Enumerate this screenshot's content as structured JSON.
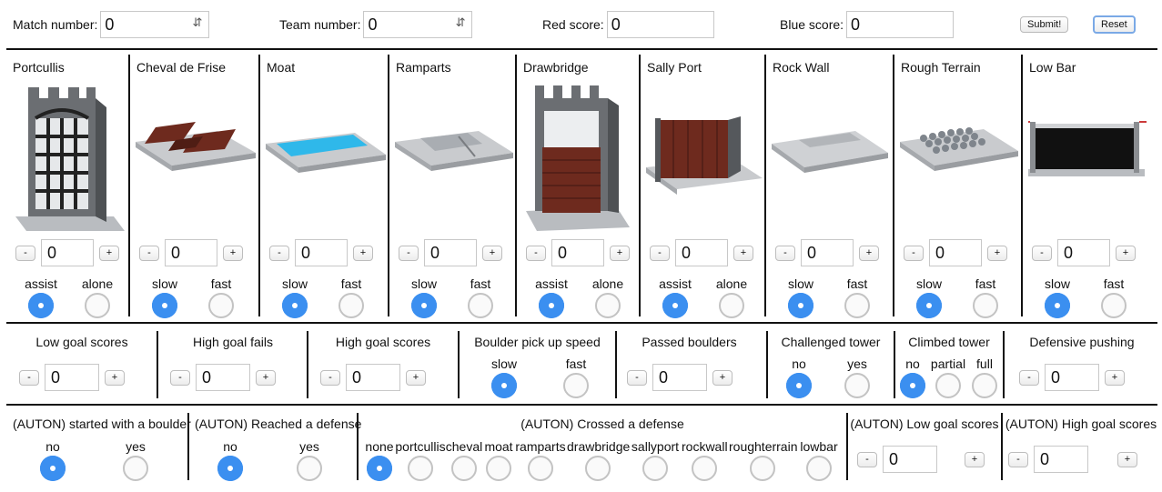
{
  "top": {
    "match_label": "Match number:",
    "match_value": "0",
    "team_label": "Team number:",
    "team_value": "0",
    "red_label": "Red score:",
    "red_value": "0",
    "blue_label": "Blue score:",
    "blue_value": "0",
    "submit_label": "Submit!",
    "reset_label": "Reset"
  },
  "defenses": [
    {
      "name": "Portcullis",
      "value": "0",
      "opt_a": "assist",
      "opt_b": "alone",
      "selected": "a",
      "icon": "portcullis-image"
    },
    {
      "name": "Cheval de Frise",
      "value": "0",
      "opt_a": "slow",
      "opt_b": "fast",
      "selected": "a",
      "icon": "cheval-de-frise-image"
    },
    {
      "name": "Moat",
      "value": "0",
      "opt_a": "slow",
      "opt_b": "fast",
      "selected": "a",
      "icon": "moat-image"
    },
    {
      "name": "Ramparts",
      "value": "0",
      "opt_a": "slow",
      "opt_b": "fast",
      "selected": "a",
      "icon": "ramparts-image"
    },
    {
      "name": "Drawbridge",
      "value": "0",
      "opt_a": "assist",
      "opt_b": "alone",
      "selected": "a",
      "icon": "drawbridge-image"
    },
    {
      "name": "Sally Port",
      "value": "0",
      "opt_a": "assist",
      "opt_b": "alone",
      "selected": "a",
      "icon": "sally-port-image"
    },
    {
      "name": "Rock Wall",
      "value": "0",
      "opt_a": "slow",
      "opt_b": "fast",
      "selected": "a",
      "icon": "rock-wall-image"
    },
    {
      "name": "Rough Terrain",
      "value": "0",
      "opt_a": "slow",
      "opt_b": "fast",
      "selected": "a",
      "icon": "rough-terrain-image"
    },
    {
      "name": "Low Bar",
      "value": "0",
      "opt_a": "slow",
      "opt_b": "fast",
      "selected": "a",
      "icon": "low-bar-image"
    }
  ],
  "stepper": {
    "minus": "-",
    "plus": "+"
  },
  "row2": {
    "low_goal_scores": {
      "label": "Low goal scores",
      "value": "0"
    },
    "high_goal_fails": {
      "label": "High goal fails",
      "value": "0"
    },
    "high_goal_scores": {
      "label": "High goal scores",
      "value": "0"
    },
    "boulder_pickup": {
      "label": "Boulder pick up speed",
      "opt_a": "slow",
      "opt_b": "fast"
    },
    "passed_boulders": {
      "label": "Passed boulders",
      "value": "0"
    },
    "challenged_tower": {
      "label": "Challenged tower",
      "opt_a": "no",
      "opt_b": "yes"
    },
    "climbed_tower": {
      "label": "Climbed tower",
      "opt_a": "no",
      "opt_b": "partial",
      "opt_c": "full"
    },
    "defensive_pushing": {
      "label": "Defensive pushing",
      "value": "0"
    }
  },
  "row3": {
    "auton_boulder": {
      "label": "(AUTON) started with a boulder",
      "opt_a": "no",
      "opt_b": "yes"
    },
    "auton_reached": {
      "label": "(AUTON) Reached a defense",
      "opt_a": "no",
      "opt_b": "yes"
    },
    "auton_crossed": {
      "label": "(AUTON) Crossed a defense",
      "options": [
        "none",
        "portcullis",
        "cheval",
        "moat",
        "ramparts",
        "drawbridge",
        "sallyport",
        "rockwall",
        "roughterrain",
        "lowbar"
      ]
    },
    "auton_low": {
      "label": "(AUTON) Low goal scores",
      "value": "0"
    },
    "auton_high": {
      "label": "(AUTON) High goal scores",
      "value": "0"
    }
  },
  "colors": {
    "radio_selected": "#3b8ff0",
    "divider": "#111111",
    "maroon": "#6e2a1e",
    "water": "#2fb8ea"
  }
}
